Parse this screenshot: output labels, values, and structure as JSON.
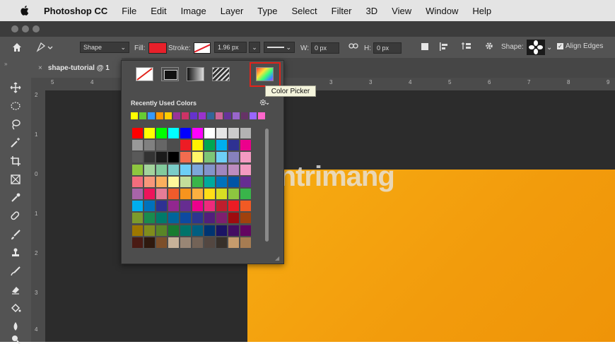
{
  "menubar": {
    "app": "Photoshop CC",
    "items": [
      "File",
      "Edit",
      "Image",
      "Layer",
      "Type",
      "Select",
      "Filter",
      "3D",
      "View",
      "Window",
      "Help"
    ]
  },
  "options": {
    "tool_mode": "Shape",
    "fill_label": "Fill:",
    "fill_color": "#e8202a",
    "stroke_label": "Stroke:",
    "stroke_width": "1.96 px",
    "w_label": "W:",
    "w_value": "0 px",
    "h_label": "H:",
    "h_value": "0 px",
    "shape_label": "Shape:",
    "align_edges": "Align Edges"
  },
  "document_tab": "shape-tutorial @ 1",
  "ruler": {
    "h_ticks": [
      "5",
      "4",
      "3",
      "2",
      "3",
      "4",
      "5",
      "6",
      "7",
      "8",
      "9"
    ],
    "v_ticks": [
      "2",
      "1",
      "0",
      "1",
      "2",
      "3",
      "4"
    ]
  },
  "panel": {
    "recent_label": "Recently Used Colors",
    "recent_colors": [
      "#ffff00",
      "#66cc33",
      "#3399ff",
      "#ff9900",
      "#ffcc00",
      "#993399",
      "#cc3366",
      "#6633cc",
      "#9933cc",
      "#336699",
      "#cc6699",
      "#663399",
      "#9966cc",
      "#663366",
      "#9966ff",
      "#ff66cc"
    ],
    "swatch_grid": [
      [
        "#ff0000",
        "#ffff00",
        "#00ff00",
        "#00ffff",
        "#0000ff",
        "#ff00ff",
        "#ffffff",
        "#e6e6e6",
        "#cccccc",
        "#b3b3b3"
      ],
      [
        "#999999",
        "#808080",
        "#666666",
        "#4d4d4d",
        "#ed1c24",
        "#fff200",
        "#00a651",
        "#00aeef",
        "#2e3192",
        "#ec008c"
      ],
      [
        "#595959",
        "#333333",
        "#1a1a1a",
        "#000000",
        "#f26c4f",
        "#fff568",
        "#7cc576",
        "#6dcff6",
        "#8781bd",
        "#f49ac2"
      ],
      [
        "#8dc63f",
        "#a3d39c",
        "#82ca9c",
        "#7accc8",
        "#6dcff6",
        "#7da7d9",
        "#8393ca",
        "#a186be",
        "#bd8cbf",
        "#f49ac1"
      ],
      [
        "#f26d7d",
        "#f7977a",
        "#fbaf5d",
        "#fff79a",
        "#c4df9b",
        "#39b54a",
        "#00a99d",
        "#0072bc",
        "#0054a6",
        "#662d91"
      ],
      [
        "#a864a8",
        "#ed145b",
        "#e57c98",
        "#ef5b2b",
        "#f7941d",
        "#fbb040",
        "#ffde17",
        "#d7df23",
        "#8dc63f",
        "#39b54a"
      ],
      [
        "#00aeef",
        "#0072bc",
        "#2e3192",
        "#92278f",
        "#662d91",
        "#ec008c",
        "#ee2a7b",
        "#be1e2d",
        "#ed1c24",
        "#f15a24"
      ],
      [
        "#7c9a2c",
        "#198b4e",
        "#007a6a",
        "#00659b",
        "#0d4aa0",
        "#2c3690",
        "#511f7b",
        "#7e1f6f",
        "#9e0b0f",
        "#a0410d"
      ],
      [
        "#9e7700",
        "#808c1d",
        "#598527",
        "#187b30",
        "#00736a",
        "#005e80",
        "#003471",
        "#1b1464",
        "#440e62",
        "#630460"
      ],
      [
        "#4a1b14",
        "#2f190e",
        "#7d4f2a",
        "#c7b299",
        "#998675",
        "#736357",
        "#534741",
        "#37302a",
        "#c69c6d",
        "#a67c52"
      ]
    ]
  },
  "tooltip": "Color Picker",
  "watermark": "uantrimang",
  "colors": {
    "accent_outline": "#e2231a",
    "canvas_orange": "#f4a20f"
  }
}
